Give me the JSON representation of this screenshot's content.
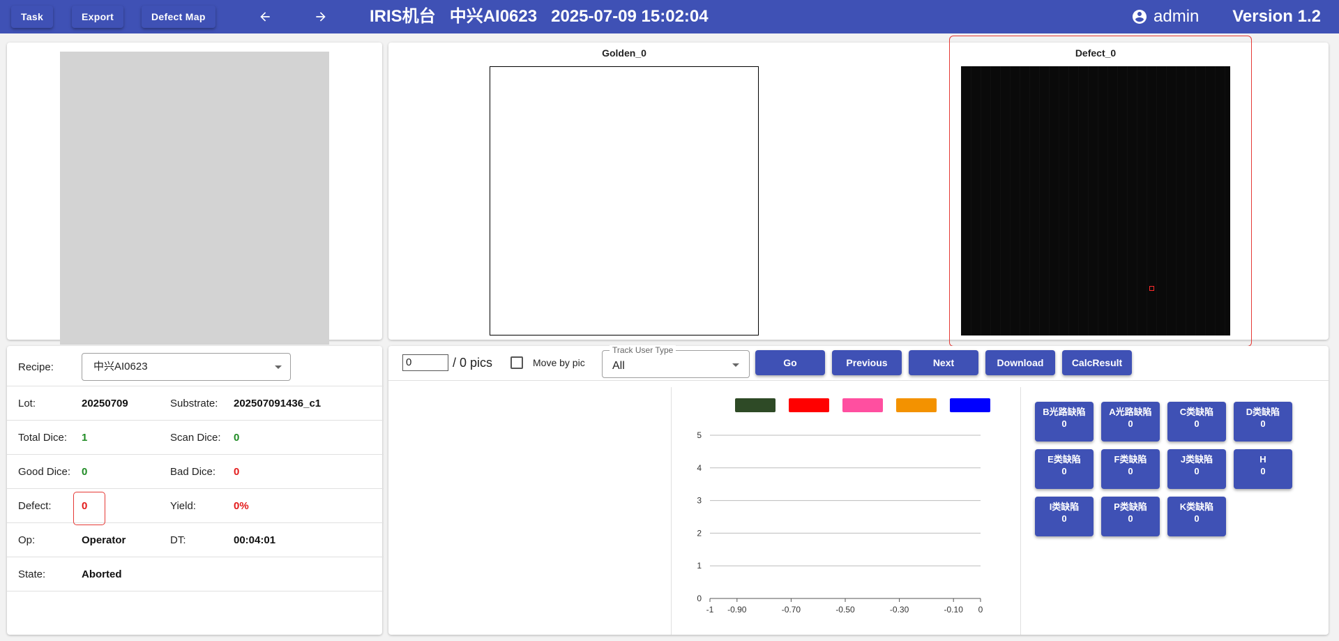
{
  "toolbar": {
    "task_label": "Task",
    "export_label": "Export",
    "defect_map_label": "Defect Map",
    "back_icon": "arrow-left-icon",
    "forward_icon": "arrow-right-icon",
    "machine": "IRIS机台",
    "recipe_name": "中兴AI0623",
    "datetime": "2025-07-09 15:02:04",
    "user_icon": "account-circle-icon",
    "username": "admin",
    "version": "Version 1.2"
  },
  "images": {
    "golden_title": "Golden_0",
    "defect_title": "Defect_0"
  },
  "info": {
    "recipe_label": "Recipe:",
    "recipe_value": "中兴AI0623",
    "lot_label": "Lot:",
    "lot_value": "20250709",
    "substrate_label": "Substrate:",
    "substrate_value": "202507091436_c1",
    "total_dice_label": "Total Dice:",
    "total_dice_value": "1",
    "scan_dice_label": "Scan Dice:",
    "scan_dice_value": "0",
    "good_dice_label": "Good Dice:",
    "good_dice_value": "0",
    "bad_dice_label": "Bad Dice:",
    "bad_dice_value": "0",
    "defect_label": "Defect:",
    "defect_value": "0",
    "yield_label": "Yield:",
    "yield_value": "0%",
    "op_label": "Op:",
    "op_value": "Operator",
    "dt_label": "DT:",
    "dt_value": "00:04:01",
    "state_label": "State:",
    "state_value": "Aborted"
  },
  "controls": {
    "pic_index": "0",
    "pic_count": "/ 0 pics",
    "move_by_pic_label": "Move by pic",
    "move_by_pic_checked": false,
    "track_user_type_label": "Track User Type",
    "track_user_type_value": "All",
    "go_label": "Go",
    "previous_label": "Previous",
    "next_label": "Next",
    "download_label": "Download",
    "calc_result_label": "CalcResult"
  },
  "chart_data": {
    "type": "line",
    "series_colors": [
      "#2e4a26",
      "#ff0000",
      "#ff4fa0",
      "#f39200",
      "#0000ff"
    ],
    "x_ticks": [
      "-1",
      "-0.90",
      "-0.70",
      "-0.50",
      "-0.30",
      "-0.10",
      "0"
    ],
    "x_tick_values": [
      -1,
      -0.9,
      -0.7,
      -0.5,
      -0.3,
      -0.1,
      0
    ],
    "y_ticks": [
      "0",
      "1",
      "2",
      "3",
      "4",
      "5"
    ],
    "xlim": [
      -1,
      0
    ],
    "ylim": [
      0,
      5
    ],
    "grid": "horizontal",
    "legend_position": "top"
  },
  "categories": [
    {
      "name": "B光路缺陷",
      "count": "0"
    },
    {
      "name": "A光路缺陷",
      "count": "0"
    },
    {
      "name": "C类缺陷",
      "count": "0"
    },
    {
      "name": "D类缺陷",
      "count": "0"
    },
    {
      "name": "E类缺陷",
      "count": "0"
    },
    {
      "name": "F类缺陷",
      "count": "0"
    },
    {
      "name": "J类缺陷",
      "count": "0"
    },
    {
      "name": "H",
      "count": "0"
    },
    {
      "name": "I类缺陷",
      "count": "0"
    },
    {
      "name": "P类缺陷",
      "count": "0"
    },
    {
      "name": "K类缺陷",
      "count": "0"
    }
  ]
}
